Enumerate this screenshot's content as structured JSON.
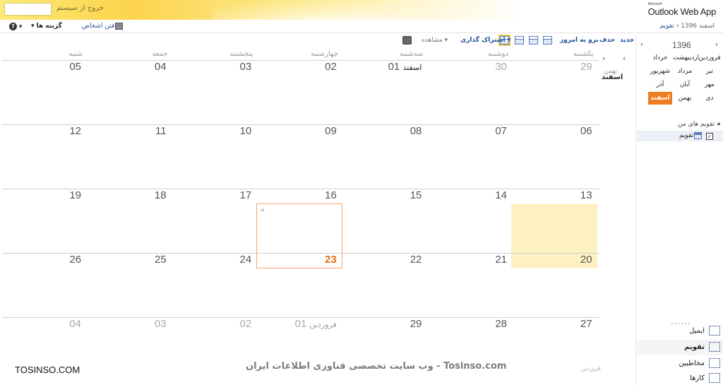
{
  "header": {
    "app_name": "Outlook Web App",
    "ms_label": "Microsoft",
    "signout": "خروج از سیستم",
    "search_placeholder": ""
  },
  "topbar": {
    "options": "گزینه ها",
    "help": "?",
    "find_people": "یافتن اشخاص",
    "breadcrumb_root": "تقویم",
    "breadcrumb_sub": "اسفند 1396"
  },
  "toolbar": {
    "new": "جدید",
    "delete": "حذف",
    "today": "برو به امروز",
    "share": "اشتراک گذاری",
    "view": "مشاهده",
    "active_view": "month"
  },
  "calendar": {
    "weekdays": [
      "یکشنبه",
      "دوشنبه",
      "سه‌شنبه",
      "چهارشنبه",
      "پنجشنبه",
      "جمعه",
      "شنبه"
    ],
    "weeks": [
      [
        {
          "d": "29",
          "dim": true
        },
        {
          "d": "30",
          "dim": true
        },
        {
          "d": "01",
          "m": "اسفند"
        },
        {
          "d": "02"
        },
        {
          "d": "03"
        },
        {
          "d": "04"
        },
        {
          "d": "05"
        }
      ],
      [
        {
          "d": "06"
        },
        {
          "d": "07"
        },
        {
          "d": "08"
        },
        {
          "d": "09"
        },
        {
          "d": "10"
        },
        {
          "d": "11"
        },
        {
          "d": "12"
        }
      ],
      [
        {
          "d": "13"
        },
        {
          "d": "14"
        },
        {
          "d": "15"
        },
        {
          "d": "16"
        },
        {
          "d": "17"
        },
        {
          "d": "18"
        },
        {
          "d": "19"
        }
      ],
      [
        {
          "d": "20",
          "highlight": true
        },
        {
          "d": "21"
        },
        {
          "d": "22"
        },
        {
          "d": "23",
          "today": true
        },
        {
          "d": "24"
        },
        {
          "d": "25"
        },
        {
          "d": "26"
        }
      ],
      [
        {
          "d": "27"
        },
        {
          "d": "28"
        },
        {
          "d": "29"
        },
        {
          "d": "01",
          "m": "فروردین",
          "dim": true
        },
        {
          "d": "02",
          "dim": true
        },
        {
          "d": "03",
          "dim": true
        },
        {
          "d": "04",
          "dim": true
        }
      ]
    ],
    "side_prev_month": "بهمن",
    "side_current_month": "اسفند",
    "footer_month": "فروردین"
  },
  "pane": {
    "year": "1396",
    "months": [
      [
        "فروردین",
        "اردیبهشت",
        "خرداد"
      ],
      [
        "تیر",
        "مرداد",
        "شهریور"
      ],
      [
        "مهر",
        "آبان",
        "آذر"
      ],
      [
        "دی",
        "بهمن",
        "اسفند"
      ]
    ],
    "selected_month": "اسفند",
    "my_calendars": "تقویم های من",
    "calendar_item": "تقویم",
    "nav": [
      "ایمیل",
      "تقویم",
      "مخاطبین",
      "کارها"
    ],
    "nav_selected": "تقویم",
    "more": "......"
  },
  "watermark": {
    "center": "وب سایت تخصصی فناوری اطلاعات ایران - Tosinso.com",
    "left": "TOSINSO.COM"
  },
  "colors": {
    "accent": "#ef7d22",
    "today": "#e46c0a",
    "link": "#1f4e9a",
    "highlight": "#fdf1c1"
  }
}
